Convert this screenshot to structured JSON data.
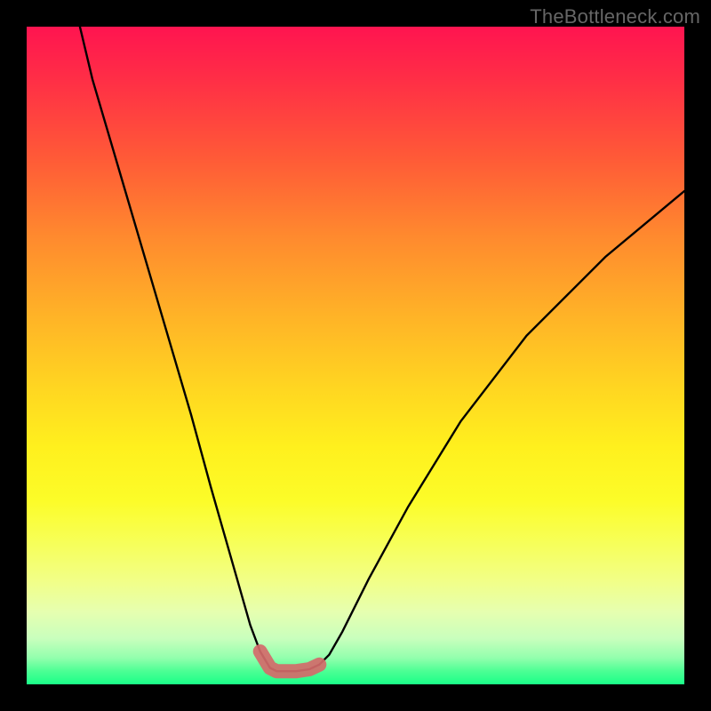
{
  "attribution": "TheBottleneck.com",
  "chart_data": {
    "type": "line",
    "title": "",
    "xlabel": "",
    "ylabel": "",
    "xlim": [
      0,
      100
    ],
    "ylim": [
      0,
      100
    ],
    "series": [
      {
        "name": "curve",
        "x": [
          8.1,
          10,
          15,
          20,
          25,
          28,
          30,
          32,
          34,
          35.5,
          37,
          38,
          39,
          41,
          43,
          44.5,
          46,
          48,
          52,
          58,
          66,
          76,
          88,
          100
        ],
        "y": [
          100,
          92,
          75,
          58,
          41,
          30,
          23,
          16,
          9,
          5,
          2.5,
          2,
          2,
          2,
          2.3,
          3,
          4.5,
          8,
          16,
          27,
          40,
          53,
          65,
          75
        ]
      }
    ],
    "highlight": {
      "name": "marker-band",
      "x": [
        35.5,
        37,
        38,
        39,
        41,
        43,
        44.5
      ],
      "y": [
        5,
        2.5,
        2,
        2,
        2,
        2.3,
        3
      ]
    },
    "colors": {
      "curve": "#000000",
      "highlight": "#d46a6a",
      "gradient_top": "#ff1450",
      "gradient_mid": "#ffe61e",
      "gradient_bottom": "#1aff88",
      "frame": "#000000"
    }
  }
}
